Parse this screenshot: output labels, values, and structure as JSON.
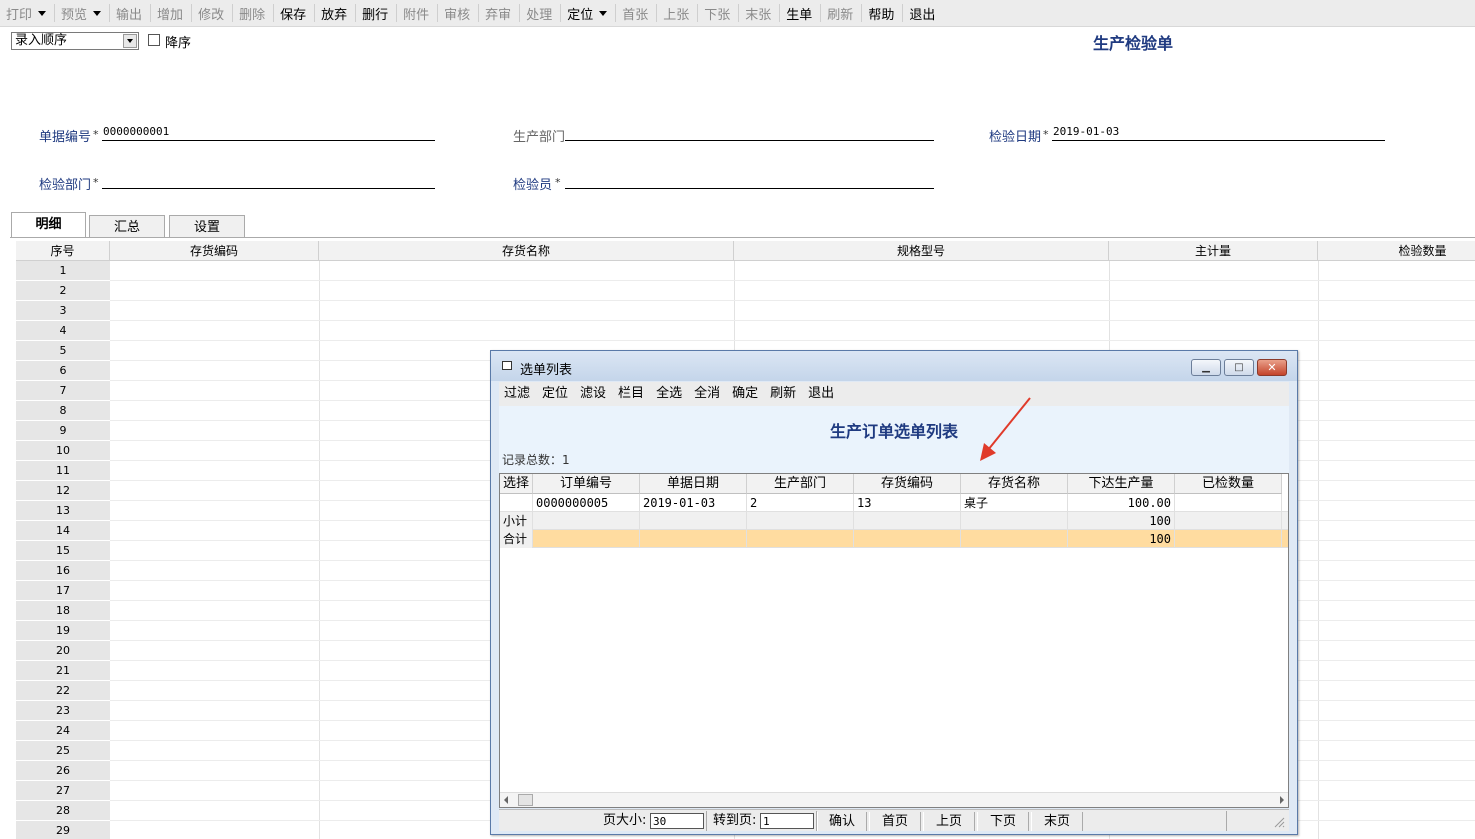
{
  "toolbar": {
    "items": [
      {
        "label": "打印",
        "dropdown": true,
        "enabled": false
      },
      {
        "label": "预览",
        "dropdown": true,
        "enabled": false
      },
      {
        "label": "输出",
        "dropdown": false,
        "enabled": false
      },
      {
        "label": "增加",
        "dropdown": false,
        "enabled": false
      },
      {
        "label": "修改",
        "dropdown": false,
        "enabled": false
      },
      {
        "label": "删除",
        "dropdown": false,
        "enabled": false
      },
      {
        "label": "保存",
        "dropdown": false,
        "enabled": true
      },
      {
        "label": "放弃",
        "dropdown": false,
        "enabled": true
      },
      {
        "label": "删行",
        "dropdown": false,
        "enabled": true
      },
      {
        "label": "附件",
        "dropdown": false,
        "enabled": false
      },
      {
        "label": "审核",
        "dropdown": false,
        "enabled": false
      },
      {
        "label": "弃审",
        "dropdown": false,
        "enabled": false
      },
      {
        "label": "处理",
        "dropdown": false,
        "enabled": false
      },
      {
        "label": "定位",
        "dropdown": true,
        "enabled": true
      },
      {
        "label": "首张",
        "dropdown": false,
        "enabled": false
      },
      {
        "label": "上张",
        "dropdown": false,
        "enabled": false
      },
      {
        "label": "下张",
        "dropdown": false,
        "enabled": false
      },
      {
        "label": "末张",
        "dropdown": false,
        "enabled": false
      },
      {
        "label": "生单",
        "dropdown": false,
        "enabled": true
      },
      {
        "label": "刷新",
        "dropdown": false,
        "enabled": false
      },
      {
        "label": "帮助",
        "dropdown": false,
        "enabled": true
      },
      {
        "label": "退出",
        "dropdown": false,
        "enabled": true
      }
    ]
  },
  "sort": {
    "value": "录入顺序",
    "desc_label": "降序",
    "desc_checked": false
  },
  "form": {
    "title": "生产检验单",
    "doc_no_label": "单据编号",
    "doc_no_value": "0000000001",
    "prod_dept_label": "生产部门",
    "prod_dept_value": "",
    "inspect_date_label": "检验日期",
    "inspect_date_value": "2019-01-03",
    "inspect_dept_label": "检验部门",
    "inspect_dept_value": "",
    "inspector_label": "检验员",
    "inspector_value": "",
    "required_mark": "*"
  },
  "tabs": [
    {
      "label": "明细",
      "active": true
    },
    {
      "label": "汇总",
      "active": false
    },
    {
      "label": "设置",
      "active": false
    }
  ],
  "grid": {
    "columns": [
      "序号",
      "存货编码",
      "存货名称",
      "规格型号",
      "主计量",
      "检验数量"
    ],
    "row_numbers": [
      "1",
      "2",
      "3",
      "4",
      "5",
      "6",
      "7",
      "8",
      "9",
      "10",
      "11",
      "12",
      "13",
      "14",
      "15",
      "16",
      "17",
      "18",
      "19",
      "20",
      "21",
      "22",
      "23",
      "24",
      "25",
      "26",
      "27",
      "28",
      "29"
    ]
  },
  "dialog": {
    "title": "选单列表",
    "toolbar": [
      "过滤",
      "定位",
      "滤设",
      "栏目",
      "全选",
      "全消",
      "确定",
      "刷新",
      "退出"
    ],
    "heading": "生产订单选单列表",
    "record_count": "记录总数：1",
    "columns": [
      "选择",
      "订单编号",
      "单据日期",
      "生产部门",
      "存货编码",
      "存货名称",
      "下达生产量",
      "已检数量"
    ],
    "rows": [
      {
        "select": "",
        "order_no": "0000000005",
        "date": "2019-01-03",
        "dept": "2",
        "item_code": "13",
        "item_name": "桌子",
        "qty": "100.00",
        "inspected": ""
      }
    ],
    "subtotal": {
      "label": "小计",
      "qty": "100"
    },
    "total": {
      "label": "合计",
      "qty": "100"
    },
    "status": {
      "page_size_label": "页大小:",
      "page_size_value": "30",
      "goto_label": "转到页:",
      "goto_value": "1",
      "confirm": "确认",
      "first": "首页",
      "prev": "上页",
      "next": "下页",
      "last": "末页"
    },
    "window_buttons": {
      "minimize": "▁",
      "maximize": "□",
      "close": "✕"
    }
  },
  "colors": {
    "accent_title": "#1f3a80",
    "total_row": "#ffdca0",
    "annotation_arrow": "#e03a2a"
  }
}
